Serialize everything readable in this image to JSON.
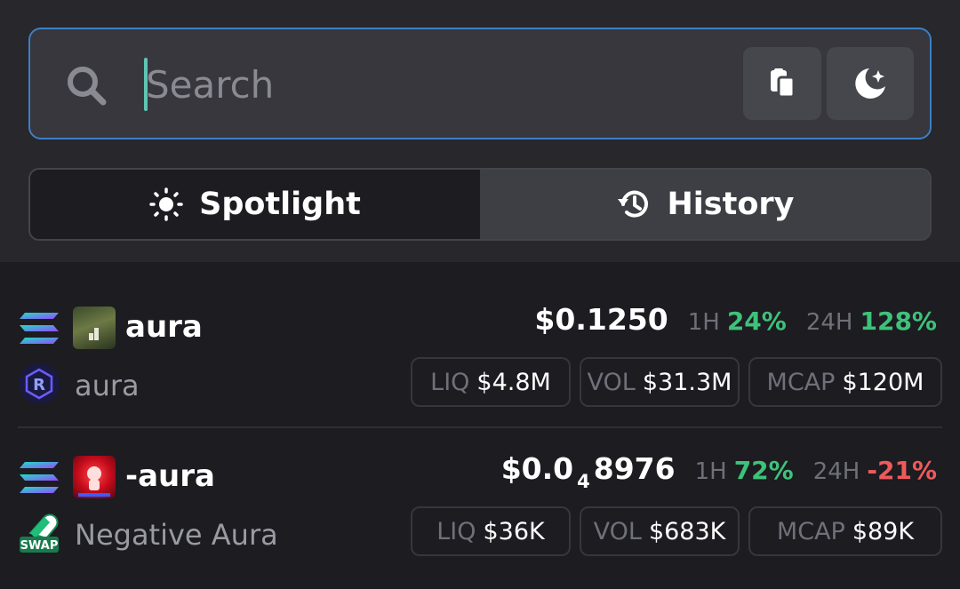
{
  "search": {
    "placeholder": "Search"
  },
  "tabs": [
    {
      "label": "Spotlight",
      "icon": "sun-icon",
      "active": true
    },
    {
      "label": "History",
      "icon": "history-icon",
      "active": false
    }
  ],
  "tokens": [
    {
      "symbol": "aura",
      "name": "aura",
      "chain_icon": "solana-icon",
      "dex_icon": "raydium-icon",
      "price_main": "$0.1250",
      "price_sub": "",
      "price_tail": "",
      "h1_label": "1H",
      "h1_change": "24%",
      "h24_label": "24H",
      "h24_change": "128%",
      "liq_label": "LIQ",
      "liq": "$4.8M",
      "vol_label": "VOL",
      "vol": "$31.3M",
      "mcap_label": "MCAP",
      "mcap": "$120M"
    },
    {
      "symbol": "-aura",
      "name": "Negative Aura",
      "chain_icon": "solana-icon",
      "dex_icon": "swap-icon",
      "dex_badge": "SWAP",
      "price_main": "$0.0",
      "price_sub": "4",
      "price_tail": "8976",
      "h1_label": "1H",
      "h1_change": "72%",
      "h24_label": "24H",
      "h24_change": "-21%",
      "liq_label": "LIQ",
      "liq": "$36K",
      "vol_label": "VOL",
      "vol": "$683K",
      "mcap_label": "MCAP",
      "mcap": "$89K"
    }
  ],
  "colors": {
    "accent_border": "#3d7fc4",
    "positive": "#3ec27a",
    "negative": "#ee5a5a",
    "background": "#1c1c21"
  }
}
